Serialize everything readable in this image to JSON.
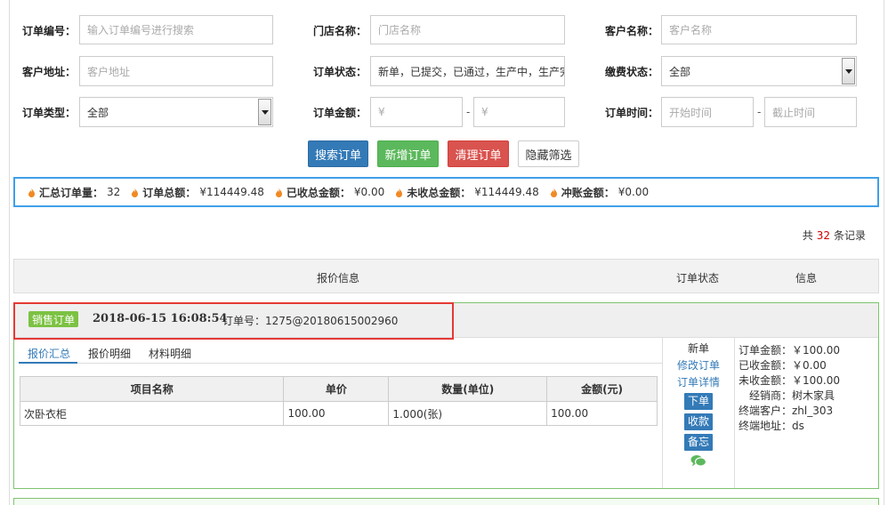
{
  "filters": {
    "order_no": {
      "label": "订单编号：",
      "placeholder": "输入订单编号进行搜索"
    },
    "store_name": {
      "label": "门店名称：",
      "placeholder": "门店名称"
    },
    "customer_name": {
      "label": "客户名称：",
      "placeholder": "客户名称"
    },
    "customer_address": {
      "label": "客户地址：",
      "placeholder": "客户地址"
    },
    "order_status": {
      "label": "订单状态：",
      "value": "新单，已提交，已通过，生产中，生产完"
    },
    "payment_status": {
      "label": "缴费状态：",
      "value": "全部"
    },
    "order_type": {
      "label": "订单类型：",
      "value": "全部"
    },
    "order_amount": {
      "label": "订单金额：",
      "min_placeholder": "¥",
      "max_placeholder": "¥",
      "separator": "-"
    },
    "order_time": {
      "label": "订单时间：",
      "start_placeholder": "开始时间",
      "end_placeholder": "截止时间",
      "separator": "-"
    }
  },
  "actions": {
    "search": "搜索订单",
    "new": "新增订单",
    "clear": "清理订单",
    "hide_filter": "隐藏筛选"
  },
  "summary": {
    "total_count_label": "汇总订单量：",
    "total_count": "32",
    "total_amount_label": "订单总额：",
    "total_amount": "¥114449.48",
    "received_label": "已收总金额：",
    "received": "¥0.00",
    "unreceived_label": "未收总金额：",
    "unreceived": "¥114449.48",
    "offset_label": "冲账金额：",
    "offset": "¥0.00"
  },
  "records": {
    "prefix": "共",
    "count": "32",
    "suffix": "条记录"
  },
  "table_header": {
    "quote_info": "报价信息",
    "order_status": "订单状态",
    "info": "信息"
  },
  "order": {
    "tag": "销售订单",
    "datetime": "2018-06-15 16:08:54",
    "order_no": "订单号：1275@20180615002960",
    "tabs": [
      "报价汇总",
      "报价明细",
      "材料明细"
    ],
    "columns": [
      "项目名称",
      "单价",
      "数量(单位)",
      "金额(元)"
    ],
    "rows": [
      [
        "次卧衣柜",
        "100.00",
        "1.000(张)",
        "100.00"
      ]
    ],
    "status": "新单",
    "links": [
      "修改订单",
      "订单详情"
    ],
    "status_buttons": [
      "下单",
      "收款",
      "备忘"
    ],
    "info": [
      "订单金额：￥100.00",
      "已收金额：￥0.00",
      "未收金额：￥100.00",
      "　经销商：树木家具",
      "终端客户：zhl_303",
      "终端地址：ds"
    ]
  },
  "colors": {
    "primary": "#337ab7",
    "success": "#5cb85c",
    "danger": "#d9534f",
    "tag": "#7cc242",
    "highlight": "#e53935",
    "flame": "#f08a24"
  }
}
